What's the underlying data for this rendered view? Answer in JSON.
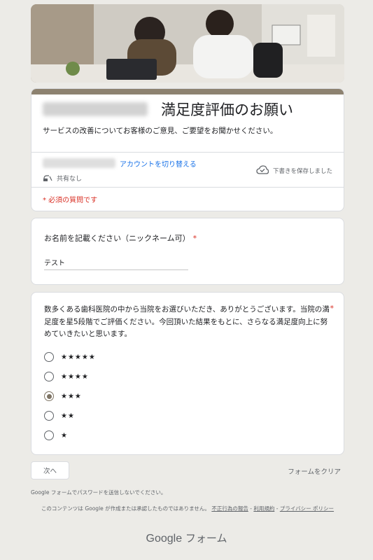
{
  "header": {
    "image": "office-consultation-photo"
  },
  "title_card": {
    "title": "満足度評価のお願い",
    "description": "サービスの改善についてお客様のご意見、ご要望をお聞かせください。",
    "switch_account": "アカウントを切り替える",
    "not_shared": "共有なし",
    "save_status": "下書きを保存しました",
    "required_note": "* 必須の質問です",
    "accent_color": "#8d8270"
  },
  "q1": {
    "label": "お名前を記載ください（ニックネーム可）",
    "required_mark": "*",
    "value": "テスト"
  },
  "q2": {
    "text": "数多くある歯科医院の中から当院をお選びいただき、ありがとうございます。当院の満足度を星5段階でご評価ください。今回頂いた結果をもとに、さらなる満足度向上に努めていきたいと思います。",
    "required_mark": "*",
    "options": [
      {
        "label": "★★★★★",
        "selected": false
      },
      {
        "label": "★★★★",
        "selected": false
      },
      {
        "label": "★★★",
        "selected": true
      },
      {
        "label": "★★",
        "selected": false
      },
      {
        "label": "★",
        "selected": false
      }
    ]
  },
  "nav": {
    "next": "次へ",
    "clear": "フォームをクリア"
  },
  "footer": {
    "password_warning": "Google フォームでパスワードを送信しないでください。",
    "disclaimer_text": "このコンテンツは Google が作成または承認したものではありません。",
    "report_link": "不正行為の報告",
    "separator": "-",
    "terms_link": "利用規約",
    "privacy_link": "プライバシー ポリシー",
    "logo_google": "Google",
    "logo_forms": "フォーム"
  }
}
